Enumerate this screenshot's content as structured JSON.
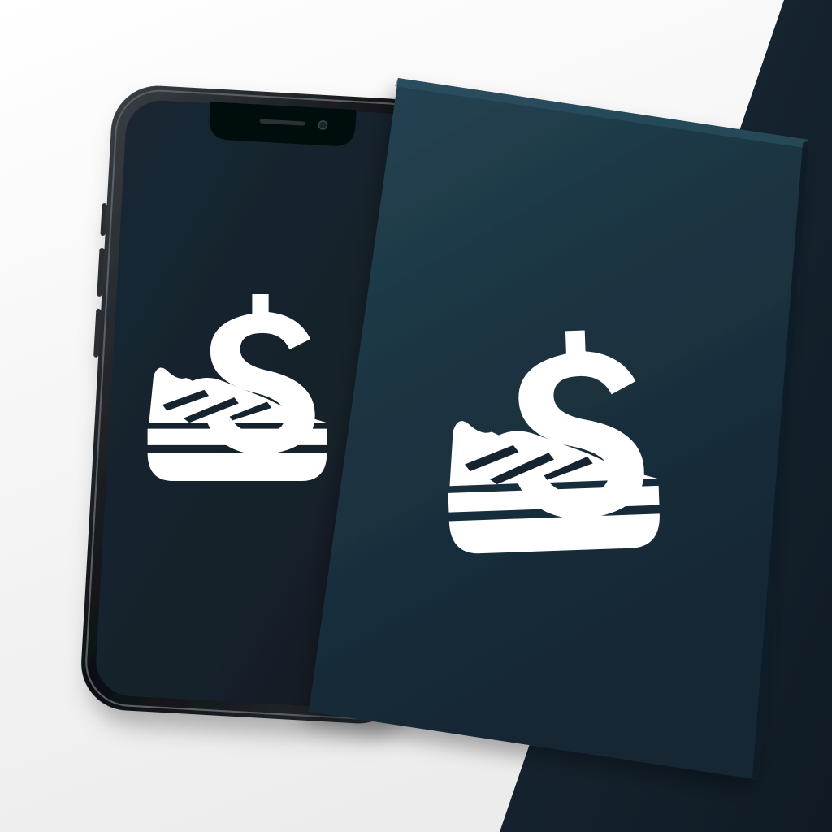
{
  "scene": {
    "subject": "mockup",
    "colors": {
      "background_light": "#f2f2f2",
      "background_dark": "#15212d",
      "phone_screen": "#16242f",
      "phone_frame": "#0f1417",
      "box_face": "#1d3440",
      "logo": "#ffffff"
    }
  },
  "logo": {
    "icon": "sneaker-dollar-icon"
  }
}
